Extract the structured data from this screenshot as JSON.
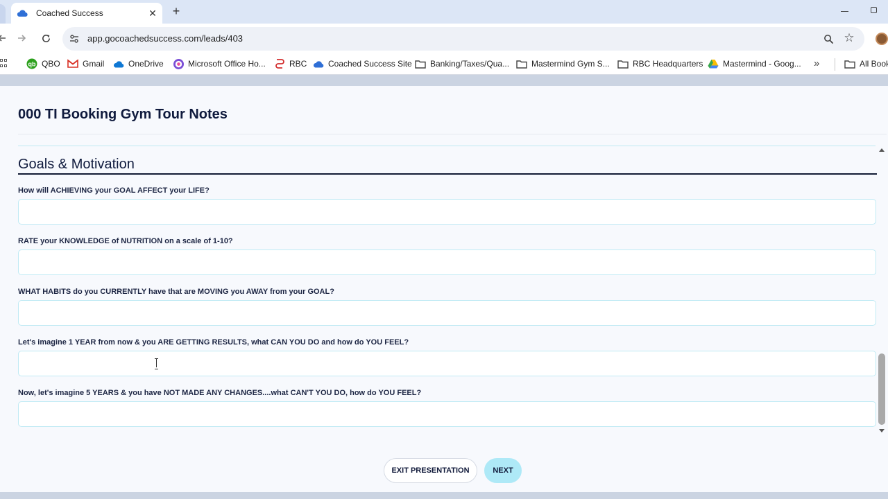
{
  "browser": {
    "tab": {
      "title": "Coached Success"
    },
    "new_tab": "+",
    "address": {
      "url": "app.gocoachedsuccess.com/leads/403"
    },
    "bookmarks": [
      {
        "label": "QBO",
        "icon": "qbo-icon"
      },
      {
        "label": "Gmail",
        "icon": "gmail-icon"
      },
      {
        "label": "OneDrive",
        "icon": "onedrive-icon"
      },
      {
        "label": "Microsoft Office Ho...",
        "icon": "office-icon"
      },
      {
        "label": "RBC",
        "icon": "rbc-icon"
      },
      {
        "label": "Coached Success Site",
        "icon": "cloud-icon"
      },
      {
        "label": "Banking/Taxes/Qua...",
        "icon": "folder-icon"
      },
      {
        "label": "Mastermind Gym S...",
        "icon": "folder-icon"
      },
      {
        "label": "RBC Headquarters",
        "icon": "folder-icon"
      },
      {
        "label": "Mastermind - Goog...",
        "icon": "google-drive-icon"
      },
      {
        "label": "All Bookmarks",
        "icon": "folder-icon"
      }
    ],
    "more_bookmarks": "»"
  },
  "page": {
    "form_title": "000 TI Booking Gym Tour Notes",
    "section_title": "Goals & Motivation",
    "questions": [
      {
        "label": "How will ACHIEVING your GOAL AFFECT your LIFE?",
        "value": ""
      },
      {
        "label": "RATE your KNOWLEDGE of NUTRITION on a scale of 1-10?",
        "value": ""
      },
      {
        "label": "WHAT HABITS do you CURRENTLY have that are MOVING you AWAY from your GOAL?",
        "value": ""
      },
      {
        "label": "Let's imagine 1 YEAR from now & you ARE GETTING RESULTS, what CAN YOU DO and how do YOU FEEL?",
        "value": ""
      },
      {
        "label": "Now, let's imagine 5 YEARS & you have NOT MADE ANY CHANGES....what CAN'T YOU DO, how do YOU FEEL?",
        "value": ""
      }
    ],
    "buttons": {
      "exit": "EXIT PRESENTATION",
      "next": "NEXT"
    }
  },
  "colors": {
    "accent": "#aee9f7",
    "title_text": "#0f1a3d",
    "input_border": "#bfeaf4"
  }
}
